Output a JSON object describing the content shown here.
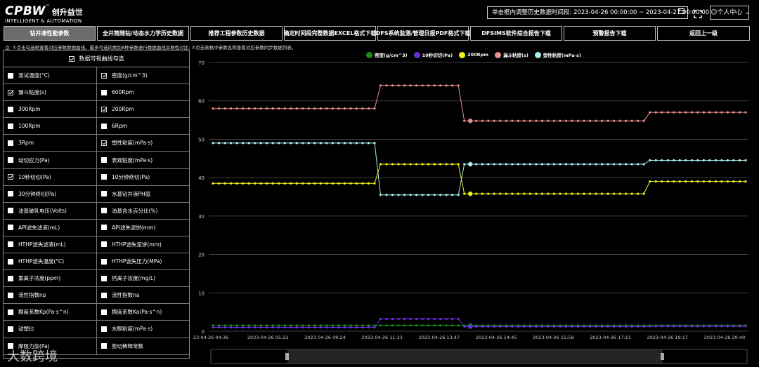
{
  "header": {
    "brand": "CPBW",
    "brand_tm": "™",
    "brand_cn": "创升益世",
    "brand_sub": "INTELLIGENT & AUTOMATION",
    "date_range_label": "单击框内调整历史数据时间段: 2023-04-26 00:00:00 ~ 2023-04-27 00:00:00",
    "calendar_icon": "calendar-icon",
    "fullscreen_icon": "fullscreen-icon",
    "user_menu": "个人中心"
  },
  "tabs": [
    {
      "label": "钻井液性能参数",
      "active": true
    },
    {
      "label": "全井筒随钻/动态水力学历史数据",
      "active": false
    },
    {
      "label": "推荐工程参数历史数据",
      "active": false
    },
    {
      "label": "确定时间段完整数据EXCEL格式下载",
      "active": false
    },
    {
      "label": "DFS系统监测/管理日报PDF格式下载",
      "active": false
    },
    {
      "label": "DFSIMS软件综合报告下载",
      "active": false
    },
    {
      "label": "预警报告下载",
      "active": false
    },
    {
      "label": "返回上一级",
      "active": false
    }
  ],
  "note": "注: ①点击勾选框查看对应参数数据曲线。最多可选同类别8种参数进行数据曲线关联性对比; ②点击表格中参数名称查看对应参数同步数据列表。",
  "panel": {
    "header": "数据可视曲线勾选",
    "rows": [
      [
        {
          "label": "测试温度(°C)",
          "checked": false
        },
        {
          "label": "密度(g/cm^3)",
          "checked": true
        }
      ],
      [
        {
          "label": "漏斗粘度(s)",
          "checked": true
        },
        {
          "label": "600Rpm",
          "checked": false
        }
      ],
      [
        {
          "label": "300Rpm",
          "checked": false
        },
        {
          "label": "200Rpm",
          "checked": true
        }
      ],
      [
        {
          "label": "100Rpm",
          "checked": false
        },
        {
          "label": "6Rpm",
          "checked": false
        }
      ],
      [
        {
          "label": "3Rpm",
          "checked": false
        },
        {
          "label": "塑性粘度(mPa·s)",
          "checked": true
        }
      ],
      [
        {
          "label": "动切应力(Pa)",
          "checked": false
        },
        {
          "label": "表观粘度(mPa·s)",
          "checked": false
        }
      ],
      [
        {
          "label": "10秒切切(Pa)",
          "checked": true
        },
        {
          "label": "10分钟终切(Pa)",
          "checked": false
        }
      ],
      [
        {
          "label": "30分钟终切(Pa)",
          "checked": false
        },
        {
          "label": "水基钻井液PH值",
          "checked": false
        }
      ],
      [
        {
          "label": "油基破乳电压(Volts)",
          "checked": false
        },
        {
          "label": "油基含水百分比(%)",
          "checked": false
        }
      ],
      [
        {
          "label": "API滤失滤液(mL)",
          "checked": false
        },
        {
          "label": "API滤失泥饼(mm)",
          "checked": false
        }
      ],
      [
        {
          "label": "HTHP滤失滤液(mL)",
          "checked": false
        },
        {
          "label": "HTHP滤失泥饼(mm)",
          "checked": false
        }
      ],
      [
        {
          "label": "HTHP滤失温度(°C)",
          "checked": false
        },
        {
          "label": "HTHP滤失压力(MPa)",
          "checked": false
        }
      ],
      [
        {
          "label": "氯离子浓度(ppm)",
          "checked": false
        },
        {
          "label": "钙离子浓度(mg/L)",
          "checked": false
        }
      ],
      [
        {
          "label": "流性指数np",
          "checked": false
        },
        {
          "label": "流性指数na",
          "checked": false
        }
      ],
      [
        {
          "label": "稠度系数Kp(Pa·s^n)",
          "checked": false
        },
        {
          "label": "稠度系数Ka(Pa·s^n)",
          "checked": false
        }
      ],
      [
        {
          "label": "动塑比",
          "checked": false
        },
        {
          "label": "水眼粘度(mPa·s)",
          "checked": false
        }
      ],
      [
        {
          "label": "摩阻力加(Pa)",
          "checked": false
        },
        {
          "label": "剪切稀释常数",
          "checked": false
        }
      ]
    ]
  },
  "watermark": "大数跨境",
  "chart_data": {
    "type": "line",
    "title": "",
    "xlabel": "",
    "ylabel": "",
    "ylim": [
      0,
      70
    ],
    "yticks": [
      0,
      10,
      20,
      30,
      40,
      50,
      60,
      70
    ],
    "x_tick_labels": [
      "23-04-26 04:36",
      "2023-04-26 05:22",
      "2023-04-26 08:24",
      "2023-04-26 11:31",
      "2023-04-26 13:47",
      "2023-04-26 14:45",
      "2023-04-26 15:58",
      "2023-04-26 17:11",
      "2023-04-26 19:17",
      "2023-04-26 20:40"
    ],
    "grid": "horizontal",
    "legend_position": "top-center",
    "points_per_series": 90,
    "segments": [
      {
        "start": 0,
        "end": 27
      },
      {
        "start": 28,
        "end": 41
      },
      {
        "start": 42,
        "end": 72
      },
      {
        "start": 73,
        "end": 89
      }
    ],
    "series": [
      {
        "name": "密度(g/cm^3)",
        "color": "#1a8a1a",
        "values": [
          1.5,
          1.5,
          1.5,
          1.5
        ]
      },
      {
        "name": "10秒切切(Pa)",
        "color": "#6a2ee0",
        "values": [
          1.0,
          3.2,
          1.2,
          1.3
        ]
      },
      {
        "name": "200Rpm",
        "color": "#f2f21e",
        "values": [
          38.5,
          43.5,
          35.8,
          39.0
        ]
      },
      {
        "name": "漏斗粘度(s)",
        "color": "#e89090",
        "values": [
          58.0,
          64.0,
          54.8,
          57.0
        ]
      },
      {
        "name": "塑性粘度(mPa·s)",
        "color": "#a8eeee",
        "values": [
          49.0,
          35.5,
          43.5,
          44.5
        ]
      }
    ]
  }
}
